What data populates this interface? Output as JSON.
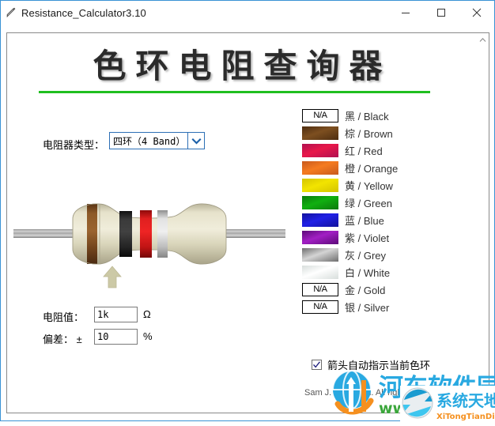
{
  "window": {
    "title": "Resistance_Calculator3.10",
    "icon": "pencil-icon",
    "minimize_label": "—",
    "maximize_label": "□",
    "close_label": "✕"
  },
  "page": {
    "heading": "色环电阻查询器",
    "rule_color": "#1fbf1f"
  },
  "form": {
    "type_label": "电阻器类型：",
    "type_value": "四环（4 Band）",
    "type_options": [
      "四环（4 Band）"
    ],
    "value_label": "电阻值：",
    "value_text": "1k",
    "value_unit": "Ω",
    "tolerance_label": "偏差： ±",
    "tolerance_text": "10",
    "tolerance_unit": "%"
  },
  "resistor": {
    "body_color": "#ddd9bb",
    "lead_color": "#9a9a9a",
    "bands": [
      {
        "name": "棕 / Brown",
        "color": "#7a4a1e"
      },
      {
        "name": "黑 / Black",
        "color": "#1c1c1c"
      },
      {
        "name": "红 / Red",
        "color": "#d31414"
      },
      {
        "name": "银 / Silver",
        "color": "#b8b8b8"
      }
    ],
    "arrow_color": "#ccc9a6",
    "arrow_points_to_band": 1
  },
  "legend": {
    "rows": [
      {
        "swatch": "N/A",
        "na": true,
        "color": "#ffffff",
        "color2": "#ffffff",
        "name": "黑 / Black"
      },
      {
        "swatch": "",
        "na": false,
        "color": "#4e2d10",
        "color2": "#7d4f20",
        "name": "棕 / Brown"
      },
      {
        "swatch": "",
        "na": false,
        "color": "#b01050",
        "color2": "#e8174a",
        "name": "红 / Red"
      },
      {
        "swatch": "",
        "na": false,
        "color": "#c85a1e",
        "color2": "#f57b20",
        "name": "橙 / Orange"
      },
      {
        "swatch": "",
        "na": false,
        "color": "#d4c400",
        "color2": "#f2e400",
        "name": "黄 / Yellow"
      },
      {
        "swatch": "",
        "na": false,
        "color": "#0c7a0c",
        "color2": "#10b010",
        "name": "绿 / Green"
      },
      {
        "swatch": "",
        "na": false,
        "color": "#12129c",
        "color2": "#2020e6",
        "name": "蓝 / Blue"
      },
      {
        "swatch": "",
        "na": false,
        "color": "#5c0a78",
        "color2": "#a21fc4",
        "name": "紫 / Violet"
      },
      {
        "swatch": "",
        "na": false,
        "color": "#6e6e6e",
        "color2": "#d4d4d4",
        "name": "灰 / Grey"
      },
      {
        "swatch": "",
        "na": false,
        "color": "#d8dedc",
        "color2": "#ffffff",
        "name": "白 / White"
      },
      {
        "swatch": "N/A",
        "na": true,
        "color": "#ffffff",
        "color2": "#ffffff",
        "name": "金 / Gold"
      },
      {
        "swatch": "N/A",
        "na": true,
        "color": "#ffffff",
        "color2": "#ffffff",
        "name": "银 / Silver"
      }
    ]
  },
  "options": {
    "auto_arrow_checked": true,
    "auto_arrow_label": "箭头自动指示当前色环"
  },
  "footer": {
    "copyright": "Sam J. Engström. All rights reserved."
  },
  "watermarks": {
    "primary_text": "河东软件园",
    "primary_sub": "www",
    "secondary_text": "系统天地",
    "secondary_sub": "XiTongTianDi.net"
  }
}
